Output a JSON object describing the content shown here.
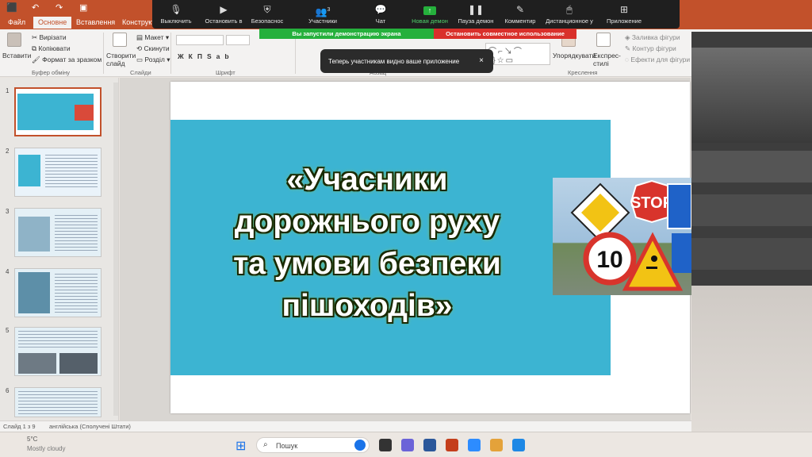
{
  "ribbon_tabs": [
    "Файл",
    "Основне",
    "Вставлення",
    "Конструктор"
  ],
  "active_tab": "Основне",
  "ribbon": {
    "paste_label": "Вставити",
    "clipboard": [
      "Вирізати",
      "Копіювати",
      "Формат за зразком"
    ],
    "clipboard_group": "Буфер обміну",
    "new_slide_label": "Створити слайд",
    "slides_items": [
      "Макет",
      "Скинути",
      "Розділ"
    ],
    "slides_group": "Слайди",
    "font_group": "Шрифт",
    "paragraph_group": "Абзац",
    "arrange_label": "Упорядкувати",
    "quick_styles_label": "Експрес-стилі",
    "drawing_right": [
      "Заливка фігури",
      "Контур фігури",
      "Ефекти для фігури"
    ],
    "drawing_group": "Креслення"
  },
  "zoom": {
    "buttons": [
      {
        "label": "Выключить",
        "icon": "microphone-icon"
      },
      {
        "label": "Остановить в",
        "icon": "camera-icon"
      },
      {
        "label": "Безопаснос",
        "icon": "shield-icon"
      },
      {
        "label": "Участники",
        "icon": "participants-icon",
        "count": "3"
      },
      {
        "label": "Чат",
        "icon": "chat-icon"
      },
      {
        "label": "Новая демон",
        "icon": "share-screen-icon"
      },
      {
        "label": "Пауза демон",
        "icon": "pause-icon"
      },
      {
        "label": "Комментир",
        "icon": "pen-icon"
      },
      {
        "label": "Дистанционное у",
        "icon": "remote-control-icon"
      },
      {
        "label": "Приложение",
        "icon": "apps-icon"
      }
    ],
    "sharing_banner": "Вы запустили демонстрацию экрана",
    "stop_sharing": "Остановить совместное использование",
    "toast": "Теперь участникам видно ваше приложение",
    "toast_close": "×"
  },
  "slide_numbers": [
    "1",
    "2",
    "3",
    "4",
    "5",
    "6"
  ],
  "slide": {
    "title_lines": [
      "«Учасники",
      "дорожнього руху",
      "та умови безпеки",
      "пішоходів»"
    ],
    "sign_texts": [
      "STOP",
      "10"
    ]
  },
  "status": {
    "slide_info": "Слайд 1 з 9",
    "language": "англійська (Сполучені Штати)"
  },
  "taskbar": {
    "search_placeholder": "Пошук",
    "weather_temp": "5°C",
    "weather_desc": "Mostly cloudy"
  },
  "colors": {
    "accent": "#c2512b",
    "slide_cyan": "#3cb4d2",
    "zoom_green": "#25b03c",
    "zoom_red": "#d9302b"
  }
}
